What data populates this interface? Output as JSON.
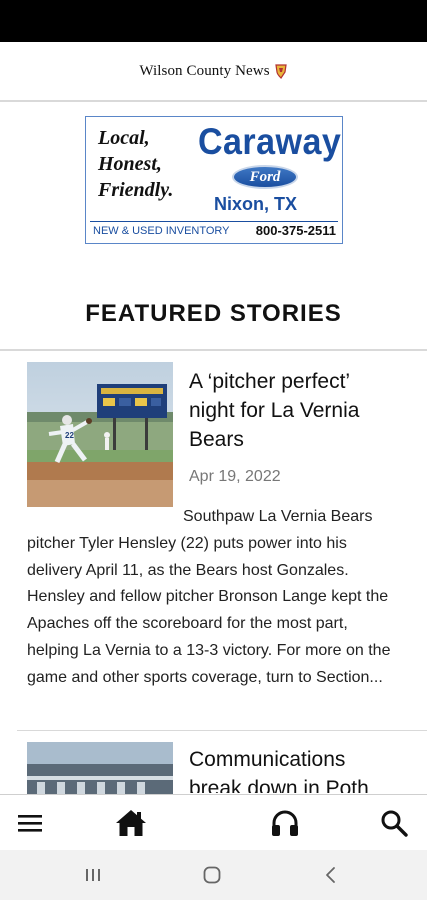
{
  "header": {
    "site_name": "Wilson County News"
  },
  "ad": {
    "tagline_1": "Local,",
    "tagline_2": "Honest,",
    "tagline_3": "Friendly.",
    "brand": "Caraway",
    "make": "Ford",
    "city": "Nixon, TX",
    "inventory": "NEW & USED INVENTORY",
    "phone": "800-375-2511"
  },
  "section": {
    "title": "FEATURED STORIES"
  },
  "stories": [
    {
      "title_line_1": "A ‘pitcher perfect’",
      "title_line_2": "night for La Vernia",
      "title_line_3": "Bears",
      "date": "Apr 19, 2022",
      "excerpt": "Southpaw La Vernia Bears pitcher Tyler Hensley (22) puts power into his delivery April 11, as the Bears host Gonzales. Hensley and fellow pitcher Bronson Lange kept the Apaches off the scoreboard for the most part, helping La Vernia to a 13-3 victory. For more on the game and other sports coverage, turn to Section..."
    },
    {
      "title_line_1": "Communications",
      "title_line_2": "break down in Poth"
    }
  ],
  "bottom_nav": {
    "items": [
      "menu-icon",
      "home-icon",
      "headphones-icon",
      "search-icon"
    ]
  },
  "colors": {
    "accent_blue": "#1a4ea0",
    "header_rule": "#d9d9d9"
  }
}
